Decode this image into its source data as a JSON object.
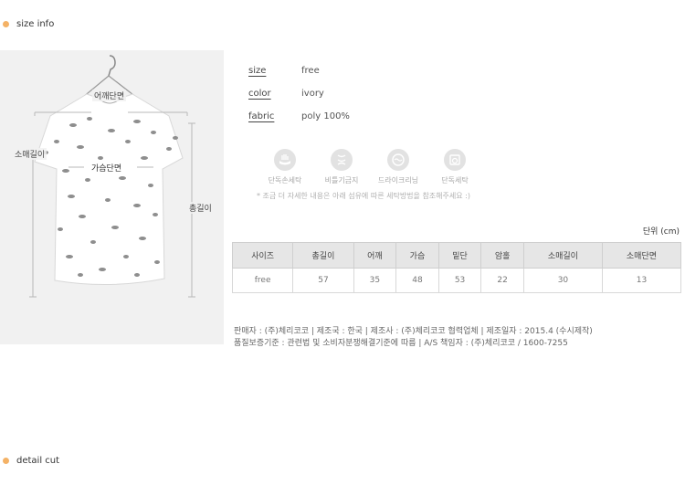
{
  "sections": {
    "size_info": "size info",
    "detail_cut": "detail cut"
  },
  "photo": {
    "labels": {
      "shoulder": "어깨단면",
      "sleeve": "소매길이",
      "chest": "가슴단면",
      "length": "총길이"
    }
  },
  "specs": [
    {
      "key": "size",
      "value": "free"
    },
    {
      "key": "color",
      "value": "ivory"
    },
    {
      "key": "fabric",
      "value": "poly 100%"
    }
  ],
  "care": {
    "items": [
      {
        "icon": "hand-wash-icon",
        "label": "단독손세탁"
      },
      {
        "icon": "no-bleach-icon",
        "label": "비틀기금지"
      },
      {
        "icon": "dry-clean-icon",
        "label": "드라이크리닝"
      },
      {
        "icon": "machine-wash-icon",
        "label": "단독세탁"
      }
    ],
    "note": "* 조금 더 자세한 내용은 아래 섬유에 따른 세탁방법을 참조해주세요 :)"
  },
  "unit": "단위 (cm)",
  "table": {
    "headers": [
      "사이즈",
      "총길이",
      "어깨",
      "가슴",
      "밑단",
      "암홀",
      "소매길이",
      "소매단면"
    ],
    "row": [
      "free",
      "57",
      "35",
      "48",
      "53",
      "22",
      "30",
      "13"
    ]
  },
  "info": {
    "line1": "판매자 : (주)체리코코 | 제조국 : 한국 | 제조사 : (주)체리코코 협력업체 | 제조일자 : 2015.4 (수시제작)",
    "line2": "품질보증기준 : 관련법 및 소비자분쟁해결기준에 따름 | A/S 책임자 : (주)체리코코 / 1600-7255"
  },
  "colors": {
    "accent_dot": "#f4b266",
    "table_header_bg": "#e6e6e6",
    "photo_bg": "#f1f1f1"
  }
}
